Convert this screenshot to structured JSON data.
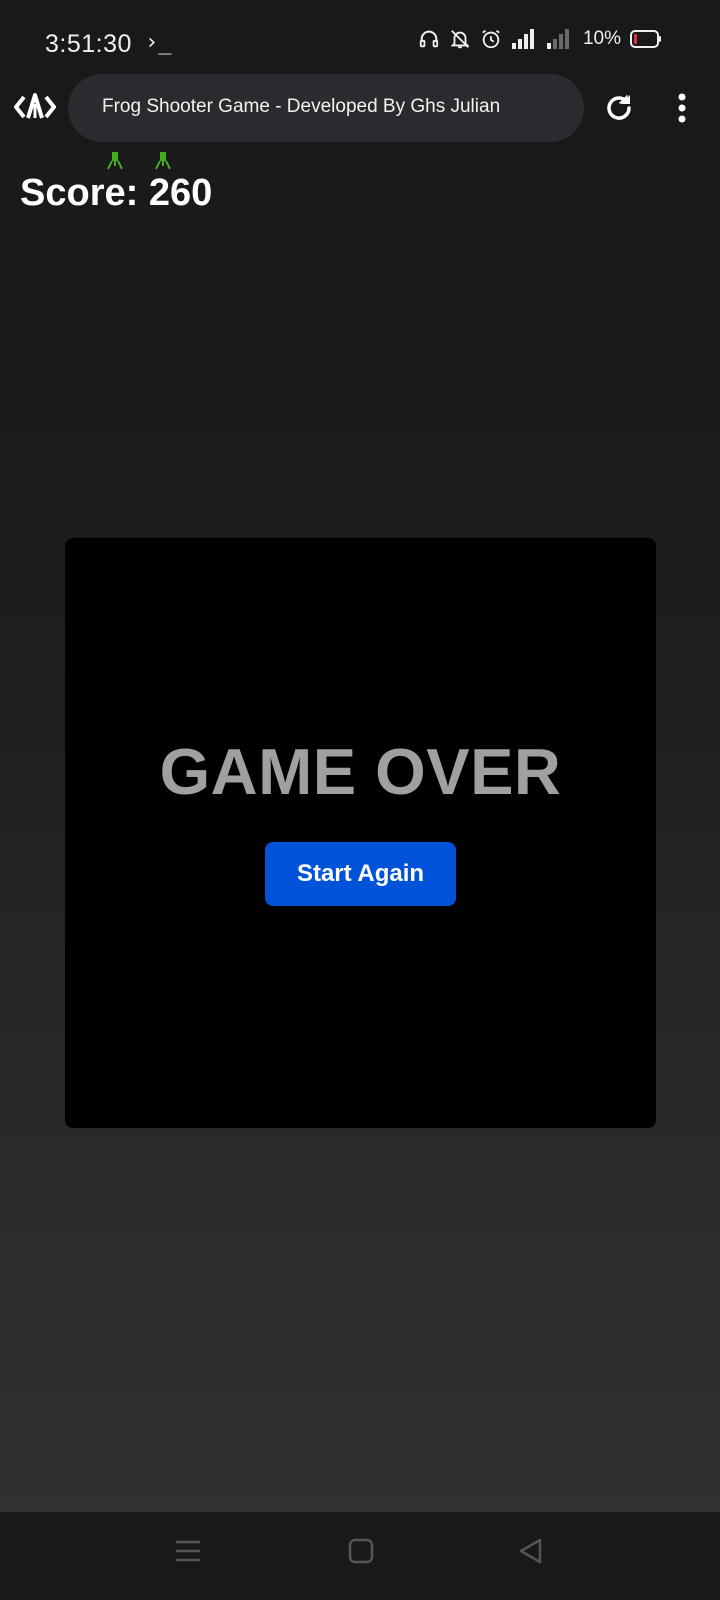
{
  "status_bar": {
    "time": "3:51:30",
    "terminal_glyph": "›_",
    "battery_percent": "10%",
    "icons": [
      "headphones-icon",
      "bell-off-icon",
      "alarm-icon",
      "signal-icon",
      "signal-weak-icon",
      "battery-low-icon"
    ]
  },
  "browser": {
    "logo_icon": "browser-logo-icon",
    "tab_title": "Frog Shooter Game - Developed By Ghs Julian",
    "reload_icon": "reload-icon",
    "menu_icon": "more-vertical-icon"
  },
  "game": {
    "score_text": "Score: 260",
    "game_over_text": "GAME OVER",
    "start_again_label": "Start Again",
    "colors": {
      "button": "#0052d9",
      "overlay": "#000000",
      "game_over_text": "#a0a0a0",
      "frog": "#3fae1f"
    }
  },
  "nav_bar": {
    "icons": [
      "recent-apps-icon",
      "home-icon",
      "back-icon"
    ]
  }
}
